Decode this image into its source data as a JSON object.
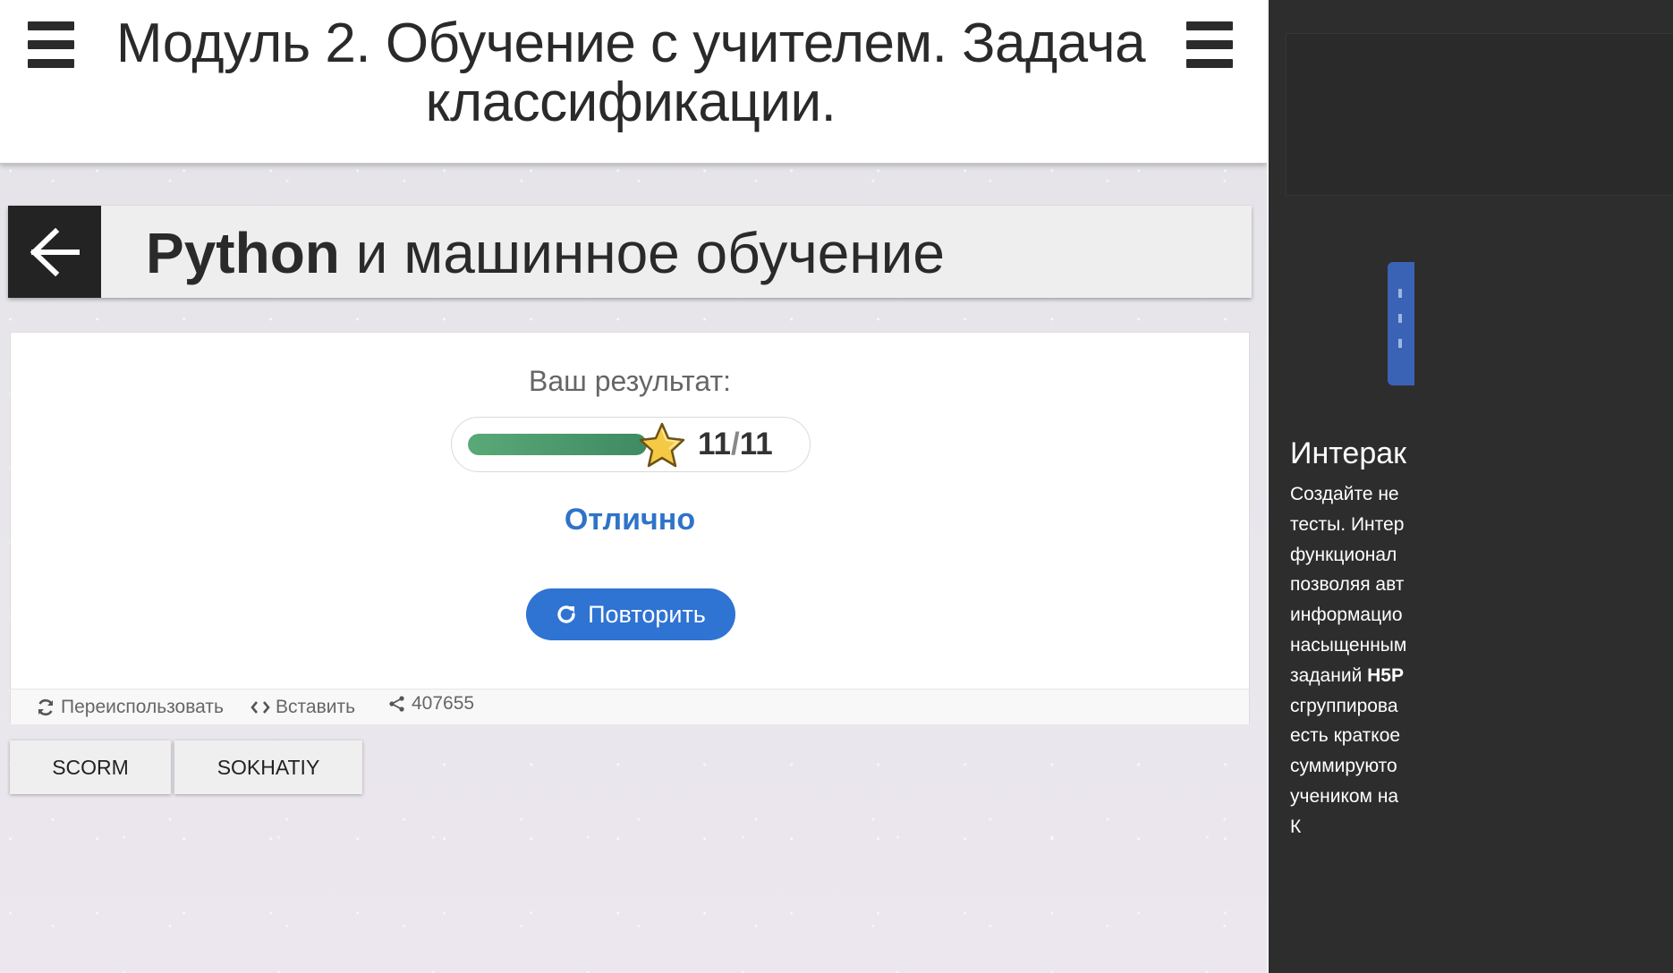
{
  "header": {
    "title_line1": "Модуль 2. Обучение с учителем. Задача",
    "title_line2": "классификации."
  },
  "course": {
    "title_bold": "Python",
    "title_rest": " и машинное обучение"
  },
  "result": {
    "label": "Ваш результат:",
    "score": "11",
    "total": "11",
    "slash": "/",
    "progress": 1.0,
    "feedback": "Отлично",
    "retry_label": "Повторить",
    "accent_color": "#2f73d3",
    "progress_color": "#4a9a6b"
  },
  "footer": {
    "reuse_label": "Переиспользовать",
    "embed_label": "Вставить",
    "share_count": "407655"
  },
  "tabs": {
    "scorm_label": "SCORM",
    "sokhatiy_label": "SOKHATIY"
  },
  "sidebar": {
    "heading": "Интерак",
    "lines": [
      "Создайте не",
      "тесты. Интер",
      "функционал",
      "позволяя авт",
      "информацио",
      "насыщенным",
      "заданий H5P",
      "сгруппирова",
      "есть краткое",
      "суммируюто",
      "учеником на",
      "К"
    ]
  },
  "icons": {
    "menu": "hamburger-icon",
    "back": "arrow-left-icon",
    "star": "star-icon",
    "retry": "refresh-icon",
    "reuse": "recycle-icon",
    "embed": "code-icon",
    "share": "share-icon"
  }
}
